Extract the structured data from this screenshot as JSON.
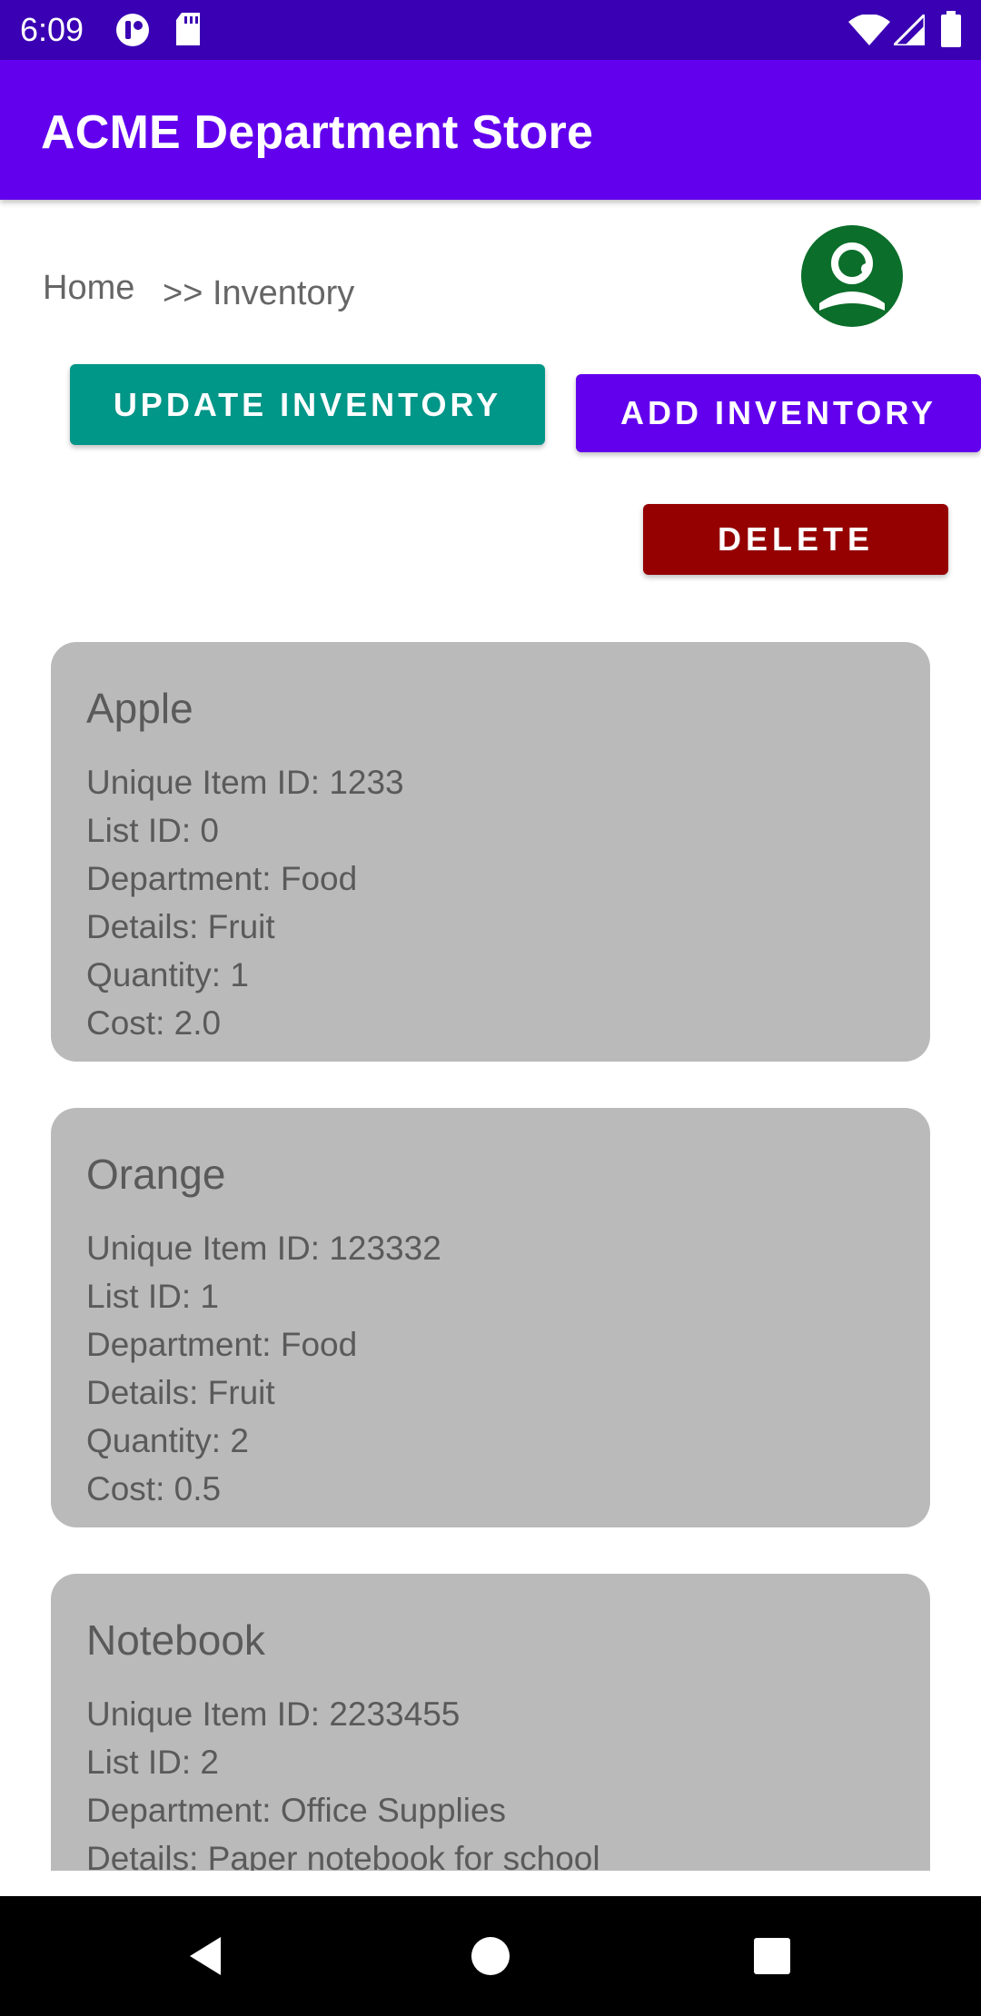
{
  "status_bar": {
    "time": "6:09"
  },
  "app_bar": {
    "title": "ACME Department Store"
  },
  "breadcrumb": {
    "home": "Home",
    "current": ">> Inventory"
  },
  "actions": {
    "update_label": "UPDATE INVENTORY",
    "add_label": "ADD INVENTORY",
    "delete_label": "DELETE"
  },
  "colors": {
    "status_bar": "#3a00b3",
    "app_bar": "#6200ee",
    "update_button": "#009688",
    "add_button": "#6200ee",
    "delete_button": "#950000",
    "avatar": "#0b6e2a",
    "card": "#bababa"
  },
  "items": [
    {
      "name": "Apple",
      "lines": [
        "Unique Item ID: 1233",
        "List ID: 0",
        "Department: Food",
        "Details: Fruit",
        "Quantity: 1",
        "Cost: 2.0"
      ]
    },
    {
      "name": "Orange",
      "lines": [
        "Unique Item ID: 123332",
        "List ID: 1",
        "Department: Food",
        "Details: Fruit",
        "Quantity: 2",
        "Cost: 0.5"
      ]
    },
    {
      "name": "Notebook",
      "lines": [
        "Unique Item ID: 2233455",
        "List ID: 2",
        "Department: Office Supplies",
        "Details: Paper notebook for school"
      ]
    }
  ],
  "icons": [
    "notification-icon",
    "sd-card-icon",
    "wifi-icon",
    "signal-icon",
    "battery-icon",
    "avatar-icon",
    "back-icon",
    "home-icon",
    "recents-icon"
  ]
}
